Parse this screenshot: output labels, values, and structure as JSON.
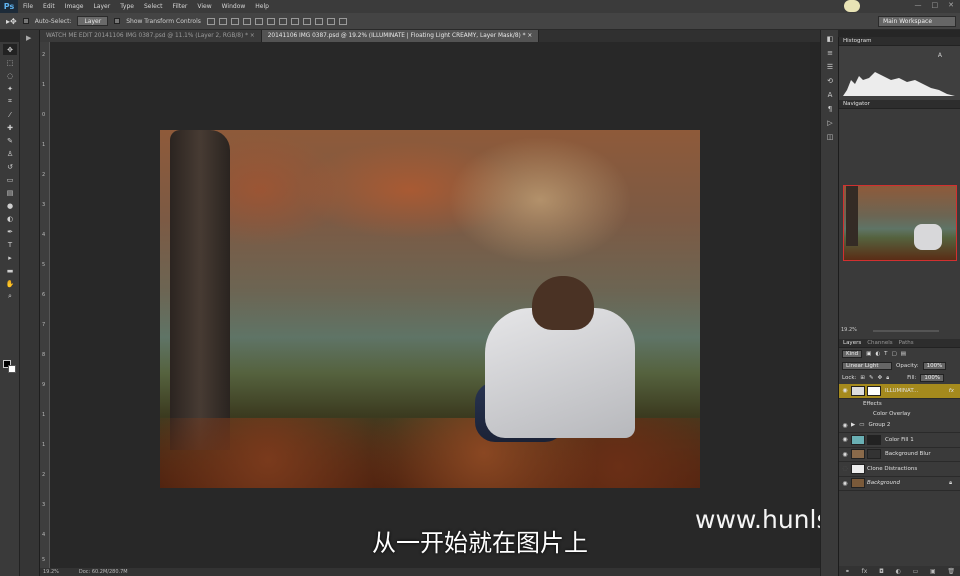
{
  "app": {
    "logo": "Ps",
    "workspace": "Main Workspace"
  },
  "menu": [
    "File",
    "Edit",
    "Image",
    "Layer",
    "Type",
    "Select",
    "Filter",
    "View",
    "Window",
    "Help"
  ],
  "window_controls": [
    "—",
    "□",
    "✕"
  ],
  "options": {
    "auto_select_label": "Auto-Select:",
    "auto_select_value": "Layer",
    "transform_label": "Show Transform Controls"
  },
  "tabs": [
    {
      "label": "WATCH ME EDIT 20141106 IMG 0387.psd @ 11.1% (Layer 2, RGB/8) * ×",
      "active": false
    },
    {
      "label": "20141106 IMG 0387.psd @ 19.2% (ILLUMINATE | Floating Light  CREAMY, Layer Mask/8) * ×",
      "active": true
    }
  ],
  "ruler_left": [
    "2",
    "1",
    "0",
    "1",
    "2",
    "3",
    "4",
    "5",
    "6",
    "7",
    "8",
    "9",
    "1",
    "1",
    "2",
    "3",
    "4",
    "5"
  ],
  "status": {
    "zoom": "19.2%",
    "doc": "Doc: 60.2M/280.7M"
  },
  "subtitle": "从一开始就在图片上",
  "watermark": "www.hunls.com",
  "panels": {
    "histogram_title": "Histogram",
    "histogram_warning": "A",
    "navigator_title": "Navigator",
    "navigator_zoom": "19.2%",
    "layers_tabs": [
      "Layers",
      "Channels",
      "Paths"
    ],
    "filter_kind": "Kind",
    "blend_mode": "Linear Light",
    "opacity_label": "Opacity:",
    "opacity_value": "100%",
    "lock_label": "Lock:",
    "fill_label": "Fill:",
    "fill_value": "100%",
    "layers": [
      {
        "name": "ILLUMINAT...",
        "fx": "fx",
        "selected": true,
        "type": "layer"
      },
      {
        "name": "Effects",
        "type": "effect"
      },
      {
        "name": "Color Overlay",
        "type": "effect-sub"
      },
      {
        "name": "Group 2",
        "type": "group"
      },
      {
        "name": "Color Fill 1",
        "type": "layer"
      },
      {
        "name": "Background Blur",
        "type": "layer"
      },
      {
        "name": "Clone Distractions",
        "type": "layer"
      },
      {
        "name": "Background",
        "type": "layer",
        "locked": true
      }
    ]
  },
  "colors": {
    "accent_selected": "#a58a1d",
    "nav_border": "#d23030"
  }
}
